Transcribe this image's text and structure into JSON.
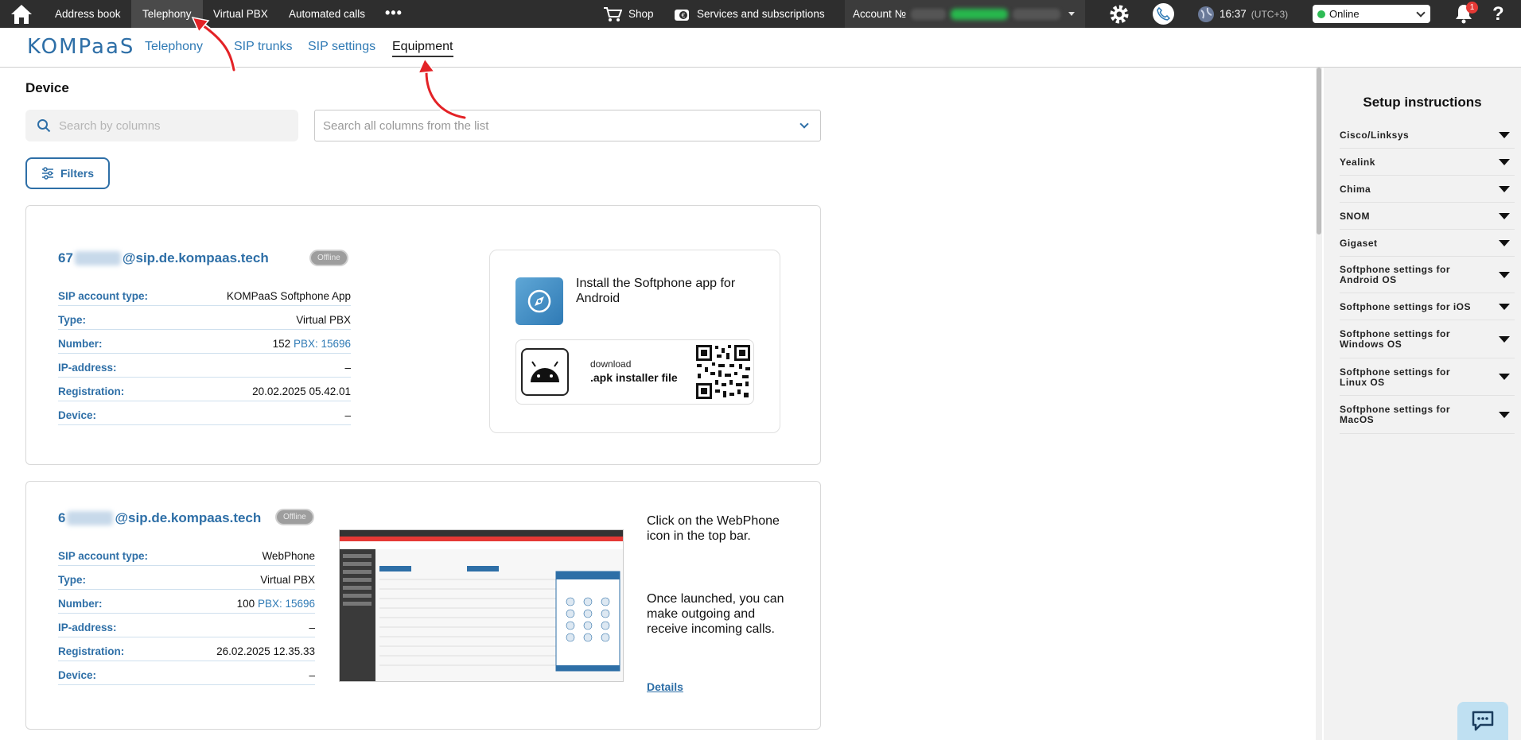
{
  "topbar": {
    "nav": [
      "Address book",
      "Telephony",
      "Virtual PBX",
      "Automated calls"
    ],
    "more": "•••",
    "shop": "Shop",
    "services": "Services and subscriptions",
    "account_label": "Account №",
    "time": "16:37",
    "timezone": "(UTC+3)",
    "status": "Online",
    "notifications": "1",
    "help": "?"
  },
  "subnav": {
    "logo": "KOMPaaS",
    "tabs": [
      "Telephony",
      "SIP trunks",
      "SIP settings",
      "Equipment"
    ]
  },
  "main": {
    "title": "Device",
    "search_placeholder": "Search by columns",
    "columns_placeholder": "Search all columns from the list",
    "filters": "Filters"
  },
  "device1": {
    "sip_prefix": "67",
    "sip_suffix": "@sip.de.kompaas.tech",
    "status": "Offline",
    "rows": [
      {
        "k": "SIP account type:",
        "v": "KOMPaaS Softphone App"
      },
      {
        "k": "Type:",
        "v": "Virtual PBX"
      },
      {
        "k": "Number:",
        "v": "152",
        "pbx": "PBX: 15696"
      },
      {
        "k": "IP-address:",
        "v": "–"
      },
      {
        "k": "Registration:",
        "v": "20.02.2025 05.42.01"
      },
      {
        "k": "Device:",
        "v": "–"
      }
    ],
    "install_title": "Install the Softphone app for Android",
    "download_line1": "download",
    "download_line2": ".apk installer file"
  },
  "device2": {
    "sip_prefix": "6",
    "sip_suffix": "@sip.de.kompaas.tech",
    "status": "Offline",
    "rows": [
      {
        "k": "SIP account type:",
        "v": "WebPhone"
      },
      {
        "k": "Type:",
        "v": "Virtual PBX"
      },
      {
        "k": "Number:",
        "v": "100",
        "pbx": "PBX: 15696"
      },
      {
        "k": "IP-address:",
        "v": "–"
      },
      {
        "k": "Registration:",
        "v": "26.02.2025 12.35.33"
      },
      {
        "k": "Device:",
        "v": "–"
      }
    ],
    "text1": "Click on the WebPhone icon in the top bar.",
    "text2": "Once launched, you can make outgoing and receive incoming calls.",
    "details": "Details"
  },
  "setup": {
    "title": "Setup instructions",
    "items": [
      "Cisco/Linksys",
      "Yealink",
      "Chima",
      "SNOM",
      "Gigaset",
      "Softphone settings for Android OS",
      "Softphone settings for iOS",
      "Softphone settings for Windows OS",
      "Softphone settings for Linux OS",
      "Softphone settings for MacOS"
    ]
  },
  "colors": {
    "accent": "#2e6fa7",
    "topbar": "#2e2e2e",
    "online": "#2dbb54",
    "arrow": "#e32226"
  }
}
